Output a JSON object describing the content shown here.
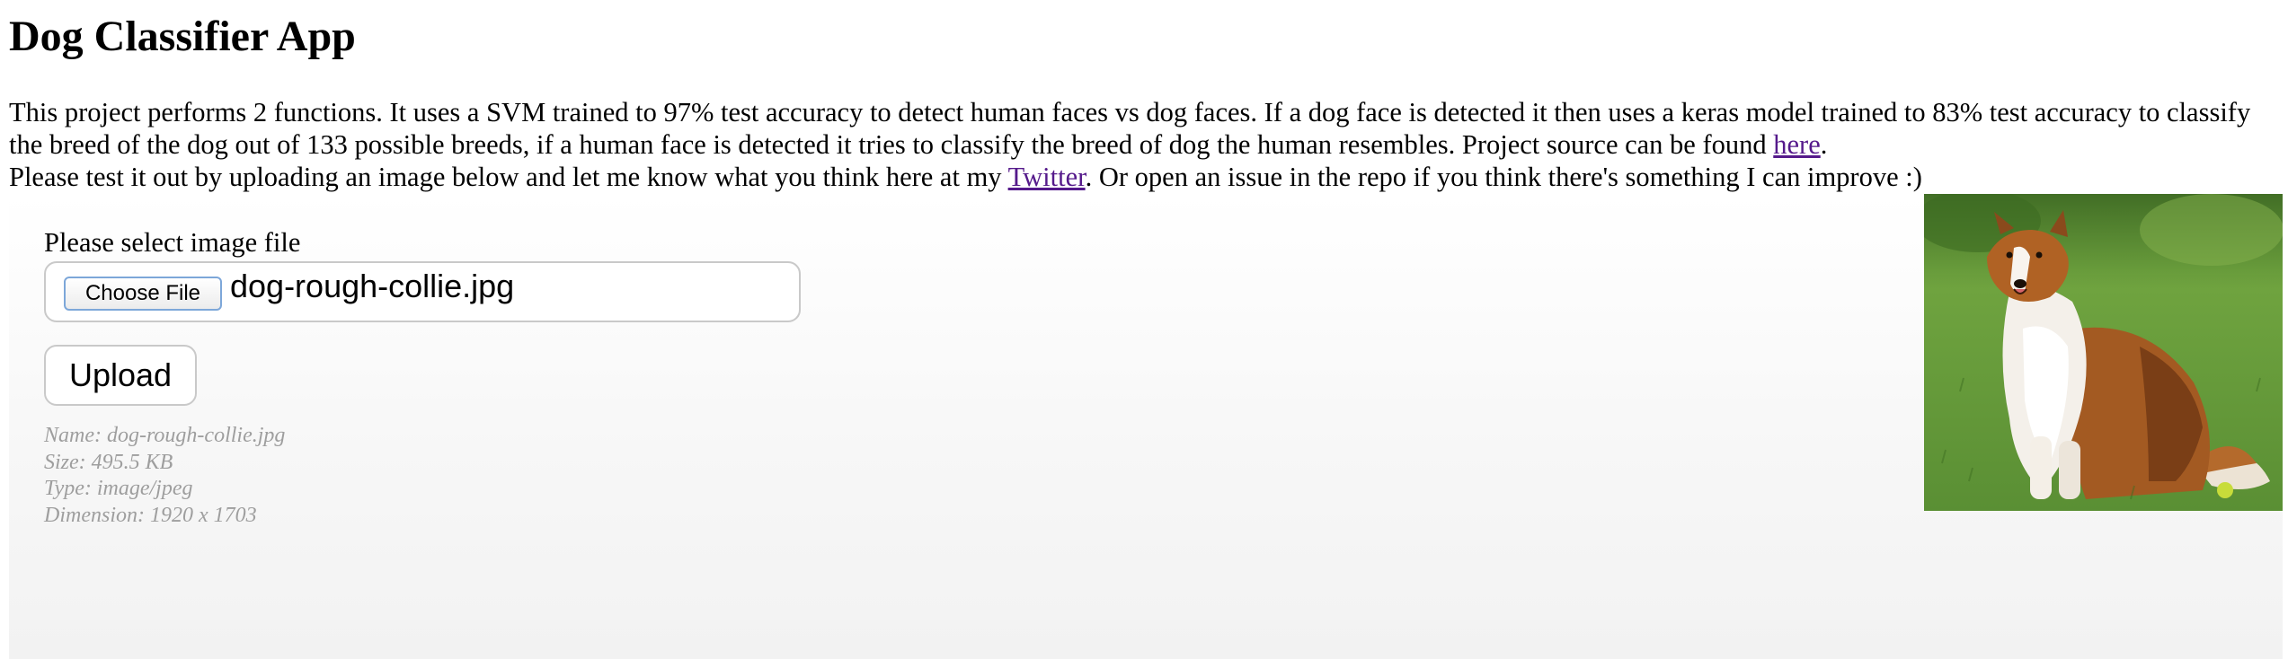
{
  "page": {
    "title": "Dog Classifier App"
  },
  "intro": {
    "paragraph_before_link": "This project performs 2 functions. It uses a SVM trained to 97% test accuracy to detect human faces vs dog faces. If a dog face is detected it then uses a keras model trained to 83% test accuracy to classify the breed of the dog out of 133 possible breeds, if a human face is detected it tries to classify the breed of dog the human resembles. Project source can be found ",
    "source_link_label": "here",
    "paragraph_after_link": ".",
    "second_before_link": "Please test it out by uploading an image below and let me know what you think here at my ",
    "twitter_link_label": "Twitter",
    "second_after_link": ". Or open an issue in the repo if you think there's something I can improve :)"
  },
  "upload": {
    "field_label": "Please select image file",
    "choose_file_label": "Choose File",
    "selected_file_name": "dog-rough-collie.jpg",
    "upload_button_label": "Upload",
    "meta": {
      "name": "Name: dog-rough-collie.jpg",
      "size": "Size: 495.5 KB",
      "type": "Type: image/jpeg",
      "dimension": "Dimension: 1920 x 1703"
    }
  },
  "preview": {
    "subject": "rough-collie-dog-photo"
  },
  "colors": {
    "link_visited": "#551a8b",
    "meta_text": "#9e9e9e",
    "border": "#c9c9c9",
    "focus_border": "#7da7d9",
    "grass": "#5f9438"
  }
}
